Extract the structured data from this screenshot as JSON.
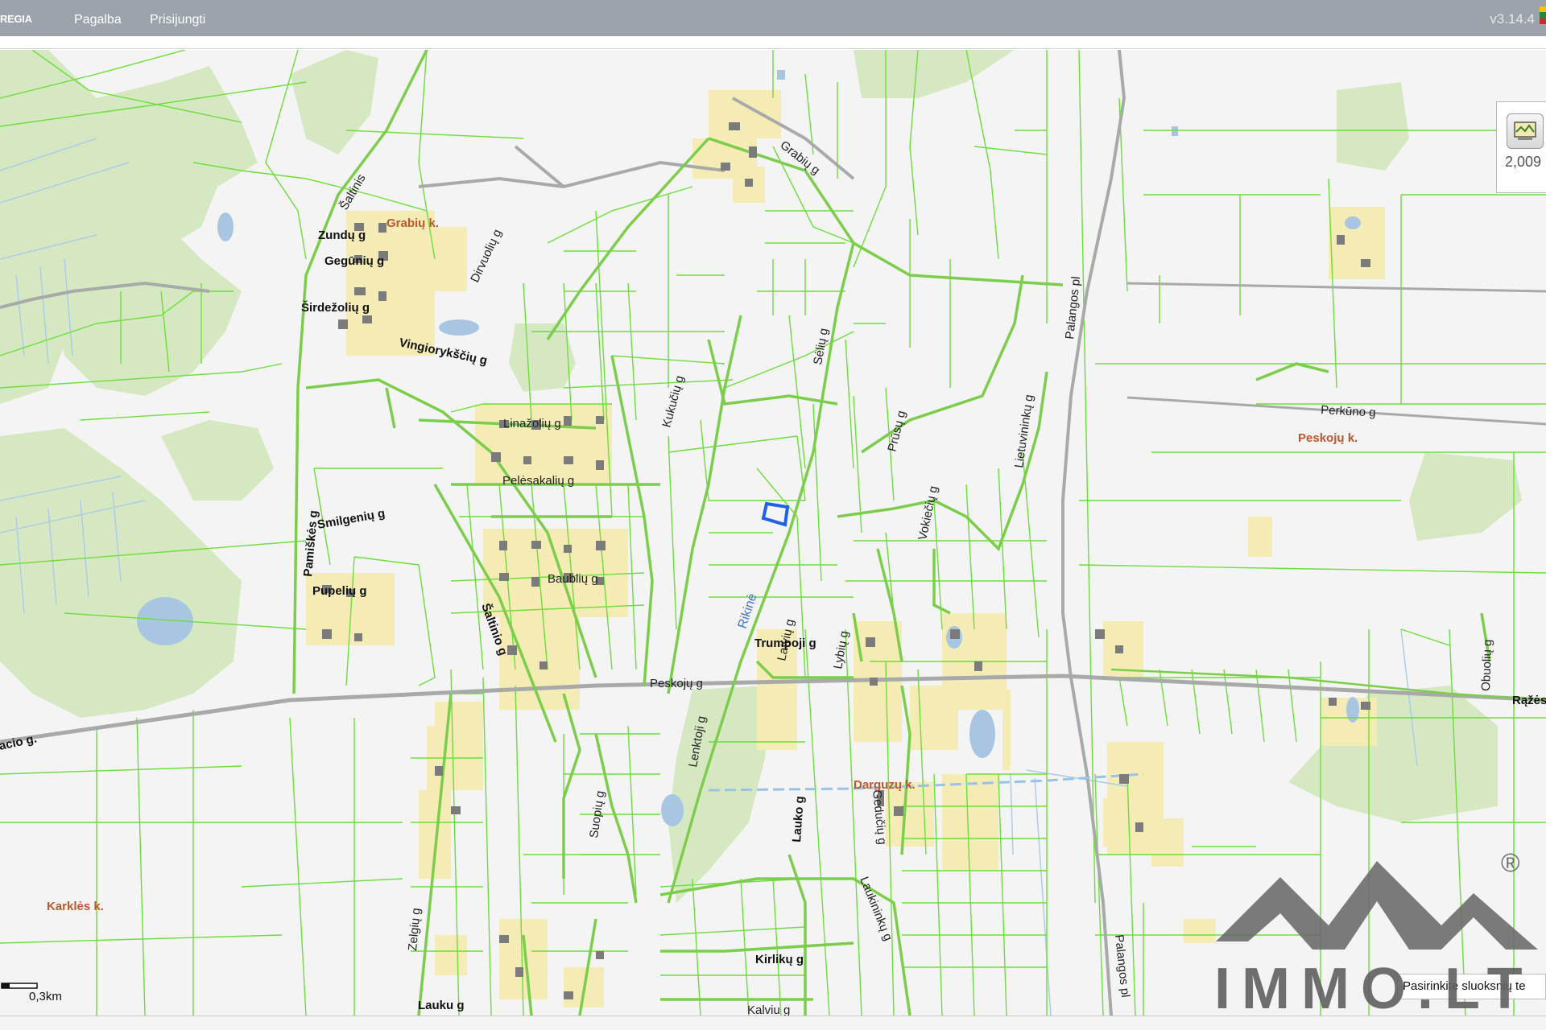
{
  "header": {
    "brand": "REGIA",
    "menu": [
      {
        "label": "Pagalba"
      },
      {
        "label": "Prisijungti"
      }
    ],
    "version": "v3.14.4"
  },
  "map": {
    "streets": [
      "Šaltinis",
      "Grabių g",
      "Zundų g",
      "Gegūnių g",
      "Dirvuolių g",
      "Širdežolių g",
      "Vingiorykščių g",
      "Linažolių g",
      "Kukučių g",
      "Sėlių g",
      "Lietuvininkų g",
      "Prūsų g",
      "Vokiečių g",
      "Smilgenių g",
      "Pelėsakalių g",
      "Pamiškės g",
      "Šaltinio g",
      "Baublių g",
      "Rikinė",
      "Latvių g",
      "Lybių g",
      "Trumpoji g",
      "Pupelių g",
      "Peskojų g",
      "Lenktoji g",
      "Suopių g",
      "Lauko g",
      "Gedučių g",
      "Laukininkų g",
      "Kirlikų g",
      "Zelgių g",
      "Lauku g",
      "Kalviu g",
      "Palangos pl",
      "Perkūno g",
      "Obuolių g",
      "Rąžės",
      "acio g."
    ],
    "villages": [
      "Grabių k.",
      "Peskojų k.",
      "Darguzų k.",
      "Karklės k."
    ],
    "scale_label": "0,3km"
  },
  "widget": {
    "value": "2,009",
    "icon": "layers-icon"
  },
  "layer_hint": "Pasirinkite sluoksnių te",
  "watermark": {
    "text": "IMMO.LT",
    "symbol": "®"
  },
  "colors": {
    "parcel": "#6cde3a",
    "road": "#a8aaa9",
    "forest": "#d6e8c2",
    "residential": "#f4ecb4",
    "water": "#a8c6e2",
    "selection": "#1f62e6",
    "header": "#9ca3aa"
  }
}
